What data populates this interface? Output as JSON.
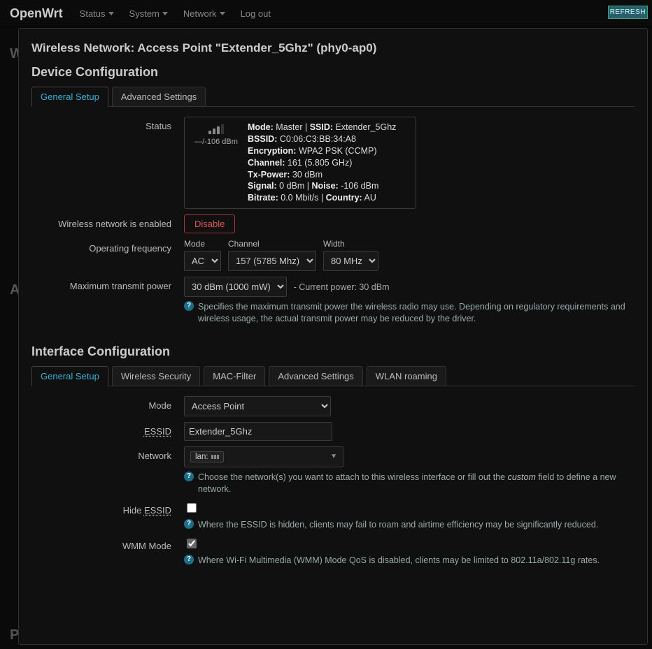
{
  "header": {
    "brand": "OpenWrt",
    "nav": [
      "Status",
      "System",
      "Network",
      "Log out"
    ],
    "refresh": "REFRESH"
  },
  "modal_title": "Wireless Network: Access Point \"Extender_5Ghz\" (phy0-ap0)",
  "device": {
    "section_title": "Device Configuration",
    "tabs": [
      "General Setup",
      "Advanced Settings"
    ],
    "status_label": "Status",
    "status_signal_text": "—/-106 dBm",
    "status": {
      "mode_k": "Mode:",
      "mode_v": "Master",
      "ssid_k": "SSID:",
      "ssid_v": "Extender_5Ghz",
      "bssid_k": "BSSID:",
      "bssid_v": "C0:06:C3:BB:34:A8",
      "enc_k": "Encryption:",
      "enc_v": "WPA2 PSK (CCMP)",
      "chan_k": "Channel:",
      "chan_v": "161 (5.805 GHz)",
      "tx_k": "Tx-Power:",
      "tx_v": "30 dBm",
      "sig_k": "Signal:",
      "sig_v": "0 dBm",
      "noise_k": "Noise:",
      "noise_v": "-106 dBm",
      "bit_k": "Bitrate:",
      "bit_v": "0.0 Mbit/s",
      "ctry_k": "Country:",
      "ctry_v": "AU"
    },
    "enabled_label": "Wireless network is enabled",
    "disable_btn": "Disable",
    "freq_label": "Operating frequency",
    "freq": {
      "mode_label": "Mode",
      "mode_value": "AC",
      "channel_label": "Channel",
      "channel_value": "157 (5785 Mhz)",
      "width_label": "Width",
      "width_value": "80 MHz"
    },
    "txpower_label": "Maximum transmit power",
    "txpower_value": "30 dBm (1000 mW)",
    "txpower_current": "- Current power: 30 dBm",
    "txpower_hint": "Specifies the maximum transmit power the wireless radio may use. Depending on regulatory requirements and wireless usage, the actual transmit power may be reduced by the driver."
  },
  "iface": {
    "section_title": "Interface Configuration",
    "tabs": [
      "General Setup",
      "Wireless Security",
      "MAC-Filter",
      "Advanced Settings",
      "WLAN roaming"
    ],
    "mode_label": "Mode",
    "mode_value": "Access Point",
    "essid_label": "ESSID",
    "essid_value": "Extender_5Ghz",
    "network_label": "Network",
    "network_value": "lan:",
    "network_hint_pre": "Choose the network(s) you want to attach to this wireless interface or fill out the ",
    "network_hint_em": "custom",
    "network_hint_post": " field to define a new network.",
    "hide_label_pre": "Hide ",
    "hide_label_essid": "ESSID",
    "hide_hint": "Where the ESSID is hidden, clients may fail to roam and airtime efficiency may be significantly reduced.",
    "wmm_label": "WMM Mode",
    "wmm_hint": "Where Wi-Fi Multimedia (WMM) Mode QoS is disabled, clients may be limited to 802.11a/802.11g rates."
  }
}
